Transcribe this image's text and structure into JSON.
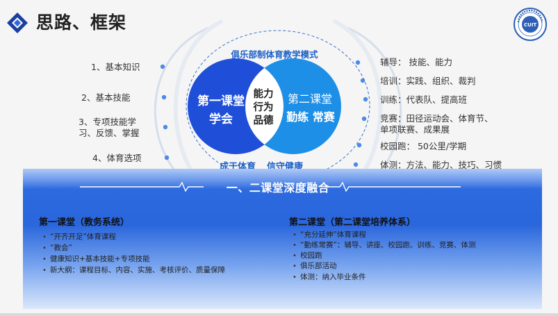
{
  "header": {
    "title": "思路、框架"
  },
  "left_items": [
    {
      "text": "1、基本知识"
    },
    {
      "text": "2、基本技能"
    },
    {
      "text": "3、专项技能学"
    },
    {
      "text": "习、反馈、掌握"
    },
    {
      "text": "4、体育选项"
    }
  ],
  "right_items": [
    "辅导： 技能、能力",
    "培训：实践、组织、裁判",
    "训练：代表队、提高班",
    "竞赛：田径运动会、体育节、",
    "单项联赛、成果展",
    "校园跑： 50公里/学期",
    "体测：方法、能力、技巧、习惯"
  ],
  "venn": {
    "model_title": "俱乐部制体育教学模式",
    "left_line1": "第一课堂",
    "left_line2": "学会",
    "right_line1": "第二课堂",
    "right_line2": "勤练 常赛",
    "center_line1": "能力",
    "center_line2": "行为",
    "center_line3": "品德",
    "motto_left": "成于体育",
    "motto_right": "信守健康"
  },
  "panel": {
    "fusion_title": "一、二课堂深度融合",
    "left": {
      "title": "第一课堂（教务系统）",
      "bullets": [
        "“开齐开足”体育课程",
        "“教会”",
        "健康知识+基本技能+专项技能",
        "新大纲：课程目标、内容、实施、考核评价、质量保障"
      ]
    },
    "right": {
      "title": "第二课堂（第二课堂培养体系）",
      "bullets": [
        "“充分延伸”体育课程",
        "“勤练常赛”：辅导、讲座、校园跑、训练、竞赛、体测",
        "校园跑",
        "俱乐部活动",
        "体测：纳入毕业条件"
      ]
    }
  },
  "colors": {
    "left_circle": "#1f4fd8",
    "right_circle": "#1e8fe6",
    "accent": "#1d5fc7",
    "panel": "#2a66dc"
  }
}
